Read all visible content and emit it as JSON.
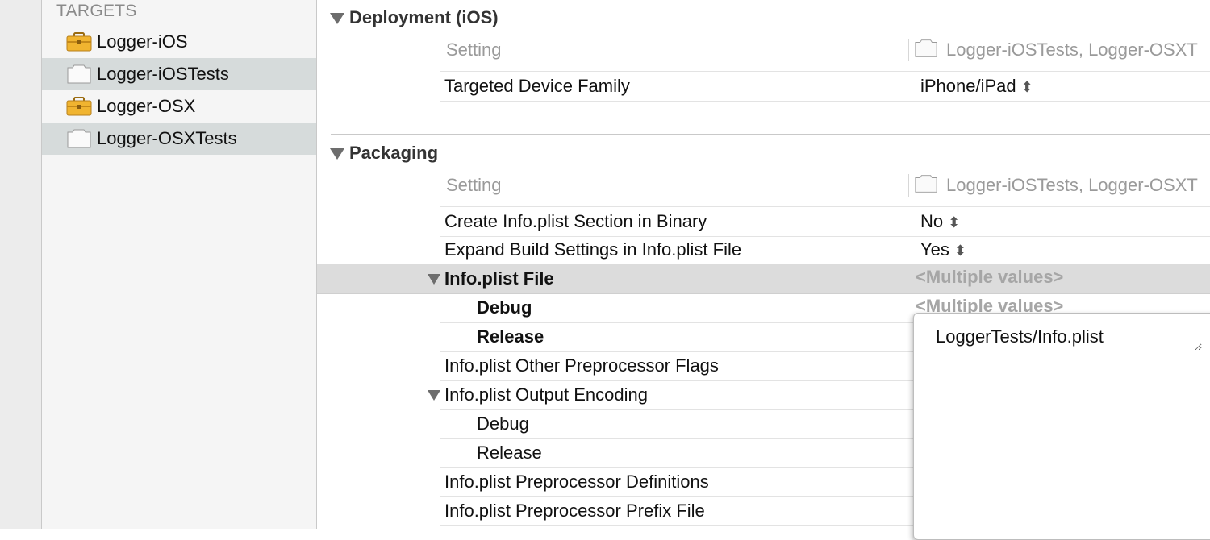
{
  "sidebar": {
    "header": "TARGETS",
    "items": [
      {
        "label": "Logger-iOS",
        "icon": "toolbox-icon"
      },
      {
        "label": "Logger-iOSTests",
        "icon": "test-bundle-icon"
      },
      {
        "label": "Logger-OSX",
        "icon": "toolbox-icon"
      },
      {
        "label": "Logger-OSXTests",
        "icon": "test-bundle-icon"
      }
    ]
  },
  "deployment": {
    "title": "Deployment (iOS)",
    "header_setting": "Setting",
    "header_targets": "Logger-iOSTests, Logger-OSXT",
    "rows": [
      {
        "label": "Targeted Device Family",
        "value": "iPhone/iPad"
      }
    ]
  },
  "packaging": {
    "title": "Packaging",
    "header_setting": "Setting",
    "header_targets": "Logger-iOSTests, Logger-OSXT",
    "rows": [
      {
        "label": "Create Info.plist Section in Binary",
        "value": "No"
      },
      {
        "label": "Expand Build Settings in Info.plist File",
        "value": "Yes"
      },
      {
        "label": "Info.plist File",
        "value": "<Multiple values>"
      },
      {
        "label": "Debug",
        "value": "<Multiple values>"
      },
      {
        "label": "Release",
        "value": ""
      },
      {
        "label": "Info.plist Other Preprocessor Flags",
        "value": ""
      },
      {
        "label": "Info.plist Output Encoding",
        "value": ""
      },
      {
        "label": "Debug",
        "value": ""
      },
      {
        "label": "Release",
        "value": ""
      },
      {
        "label": "Info.plist Preprocessor Definitions",
        "value": ""
      },
      {
        "label": "Info.plist Preprocessor Prefix File",
        "value": ""
      }
    ]
  },
  "popup": {
    "value": "LoggerTests/Info.plist"
  }
}
